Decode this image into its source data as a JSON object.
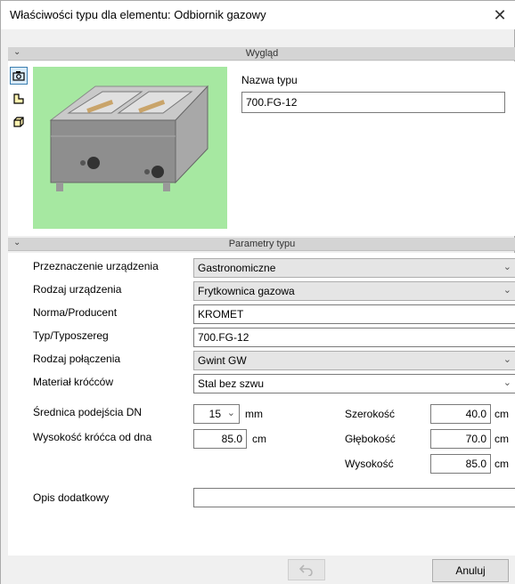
{
  "window": {
    "title": "Właściwości typu dla elementu: Odbiornik gazowy",
    "close_glyph": "✕"
  },
  "sections": {
    "look": {
      "label": "Wygląd",
      "chevron": "⌄"
    },
    "params": {
      "label": "Parametry typu",
      "chevron": "⌄"
    }
  },
  "side_toolbar": [
    {
      "icon": "camera-icon",
      "active": true
    },
    {
      "icon": "layout-icon",
      "active": false
    },
    {
      "icon": "cube-icon",
      "active": false
    }
  ],
  "preview": {
    "icon": "gas-fryer-preview",
    "background": "#a6e8a1"
  },
  "type_name": {
    "label": "Nazwa typu",
    "value": "700.FG-12"
  },
  "params": {
    "przeznaczenie": {
      "label": "Przeznaczenie urządzenia",
      "value": "Gastronomiczne"
    },
    "rodzaj": {
      "label": "Rodzaj urządzenia",
      "value": "Frytkownica gazowa"
    },
    "norma": {
      "label": "Norma/Producent",
      "value": "KROMET"
    },
    "typ": {
      "label": "Typ/Typoszereg",
      "value": "700.FG-12"
    },
    "polaczenie": {
      "label": "Rodzaj połączenia",
      "value": "Gwint GW"
    },
    "material": {
      "label": "Materiał króćców",
      "value": "Stal bez szwu"
    },
    "srednica": {
      "label": "Średnica podejścia DN",
      "value": "15",
      "unit": "mm"
    },
    "wysokosc_krocca": {
      "label": "Wysokość króćca od dna",
      "value": "85.0",
      "unit": "cm"
    },
    "szerokosc": {
      "label": "Szerokość",
      "value": "40.0",
      "unit": "cm"
    },
    "glebokosc": {
      "label": "Głębokość",
      "value": "70.0",
      "unit": "cm"
    },
    "wysokosc": {
      "label": "Wysokość",
      "value": "85.0",
      "unit": "cm"
    },
    "opis": {
      "label": "Opis dodatkowy",
      "value": ""
    }
  },
  "footer": {
    "undo_icon": "undo-icon",
    "cancel_label": "Anuluj"
  },
  "combo_arrow": "⌄"
}
